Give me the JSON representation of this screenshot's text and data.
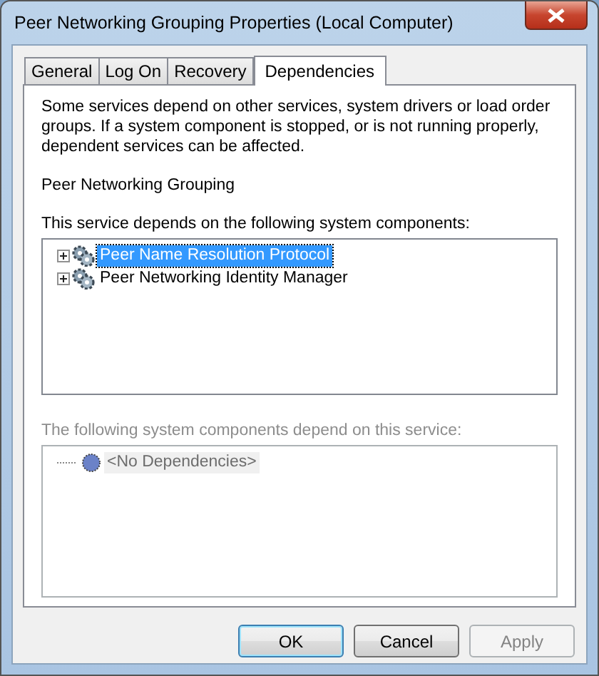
{
  "window": {
    "title": "Peer Networking Grouping Properties (Local Computer)"
  },
  "tabs": [
    {
      "label": "General",
      "selected": false
    },
    {
      "label": "Log On",
      "selected": false
    },
    {
      "label": "Recovery",
      "selected": false
    },
    {
      "label": "Dependencies",
      "selected": true
    }
  ],
  "description": "Some services depend on other services, system drivers or load order groups. If a system component is stopped, or is not running properly, dependent services can be affected.",
  "service_name": "Peer Networking Grouping",
  "depends_on": {
    "label": "This service depends on the following system components:",
    "disabled": false,
    "items": [
      {
        "label": "Peer Name Resolution Protocol",
        "expandable": true,
        "selected": true
      },
      {
        "label": "Peer Networking Identity Manager",
        "expandable": true,
        "selected": false
      }
    ]
  },
  "dependents": {
    "label": "The following system components depend on this service:",
    "disabled": true,
    "items": [
      {
        "label": "<No Dependencies>",
        "expandable": false,
        "selected": false
      }
    ]
  },
  "buttons": [
    {
      "label": "OK",
      "default": true,
      "disabled": false
    },
    {
      "label": "Cancel",
      "default": false,
      "disabled": false
    },
    {
      "label": "Apply",
      "default": false,
      "disabled": true
    }
  ]
}
